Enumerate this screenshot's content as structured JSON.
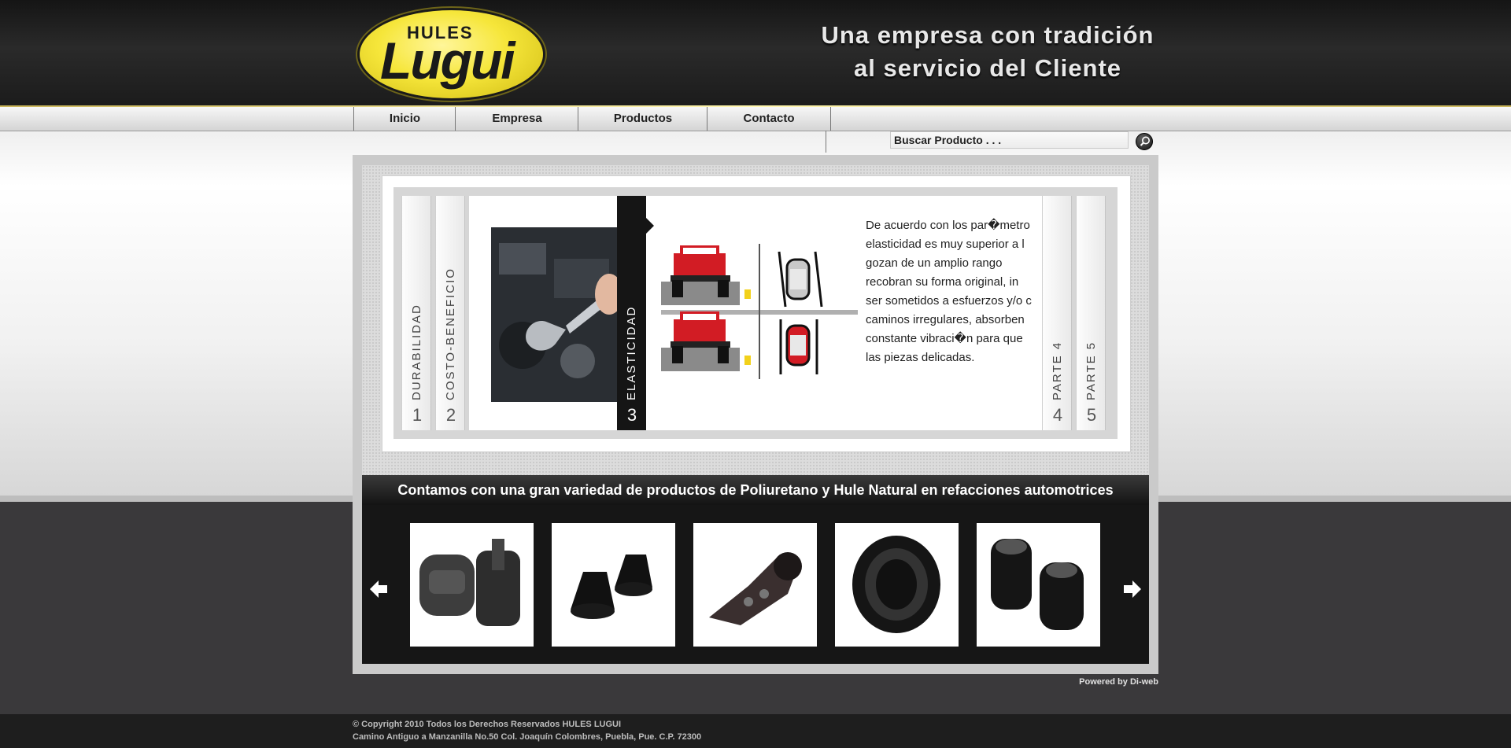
{
  "brand": {
    "logo_top": "HULES",
    "logo_main": "Lugui",
    "tagline_line1": "Una empresa con tradición",
    "tagline_line2": "al servicio del Cliente"
  },
  "nav": {
    "items": [
      {
        "label": "Inicio"
      },
      {
        "label": "Empresa"
      },
      {
        "label": "Productos"
      },
      {
        "label": "Contacto"
      }
    ]
  },
  "search": {
    "value": "Buscar Producto . . ."
  },
  "slider": {
    "tabs": [
      {
        "label": "DURABILIDAD",
        "number": "1"
      },
      {
        "label": "COSTO-BENEFICIO",
        "number": "2"
      },
      {
        "label": "ELASTICIDAD",
        "number": "3"
      },
      {
        "label": "PARTE 4",
        "number": "4"
      },
      {
        "label": "PARTE 5",
        "number": "5"
      }
    ],
    "active_tab": 3,
    "text_lines": [
      "De acuerdo con los par�metro",
      "elasticidad es muy superior a l",
      "gozan de un amplio rango",
      "recobran su forma original, in",
      "ser sometidos a esfuerzos y/o c",
      "caminos irregulares, absorben",
      "constante vibraci�n para que",
      "las piezas delicadas."
    ]
  },
  "products": {
    "heading": "Contamos con una gran variedad de productos de Poliuretano y Hule Natural en refacciones automotrices",
    "items": [
      "bushing-set",
      "rubber-bumpers",
      "bracket-mount",
      "rubber-seal-ring",
      "bushing-sleeves"
    ]
  },
  "footer": {
    "powered": "Powered by Di-web",
    "copyright": "© Copyright 2010 Todos los Derechos Reservados HULES LUGUI",
    "address": "Camino Antiguo a Manzanilla No.50 Col. Joaquín Colombres, Puebla, Pue. C.P. 72300"
  },
  "colors": {
    "logo_yellow": "#f6e63a",
    "header_dark": "#1b1b1b",
    "active_tab": "#151515"
  }
}
